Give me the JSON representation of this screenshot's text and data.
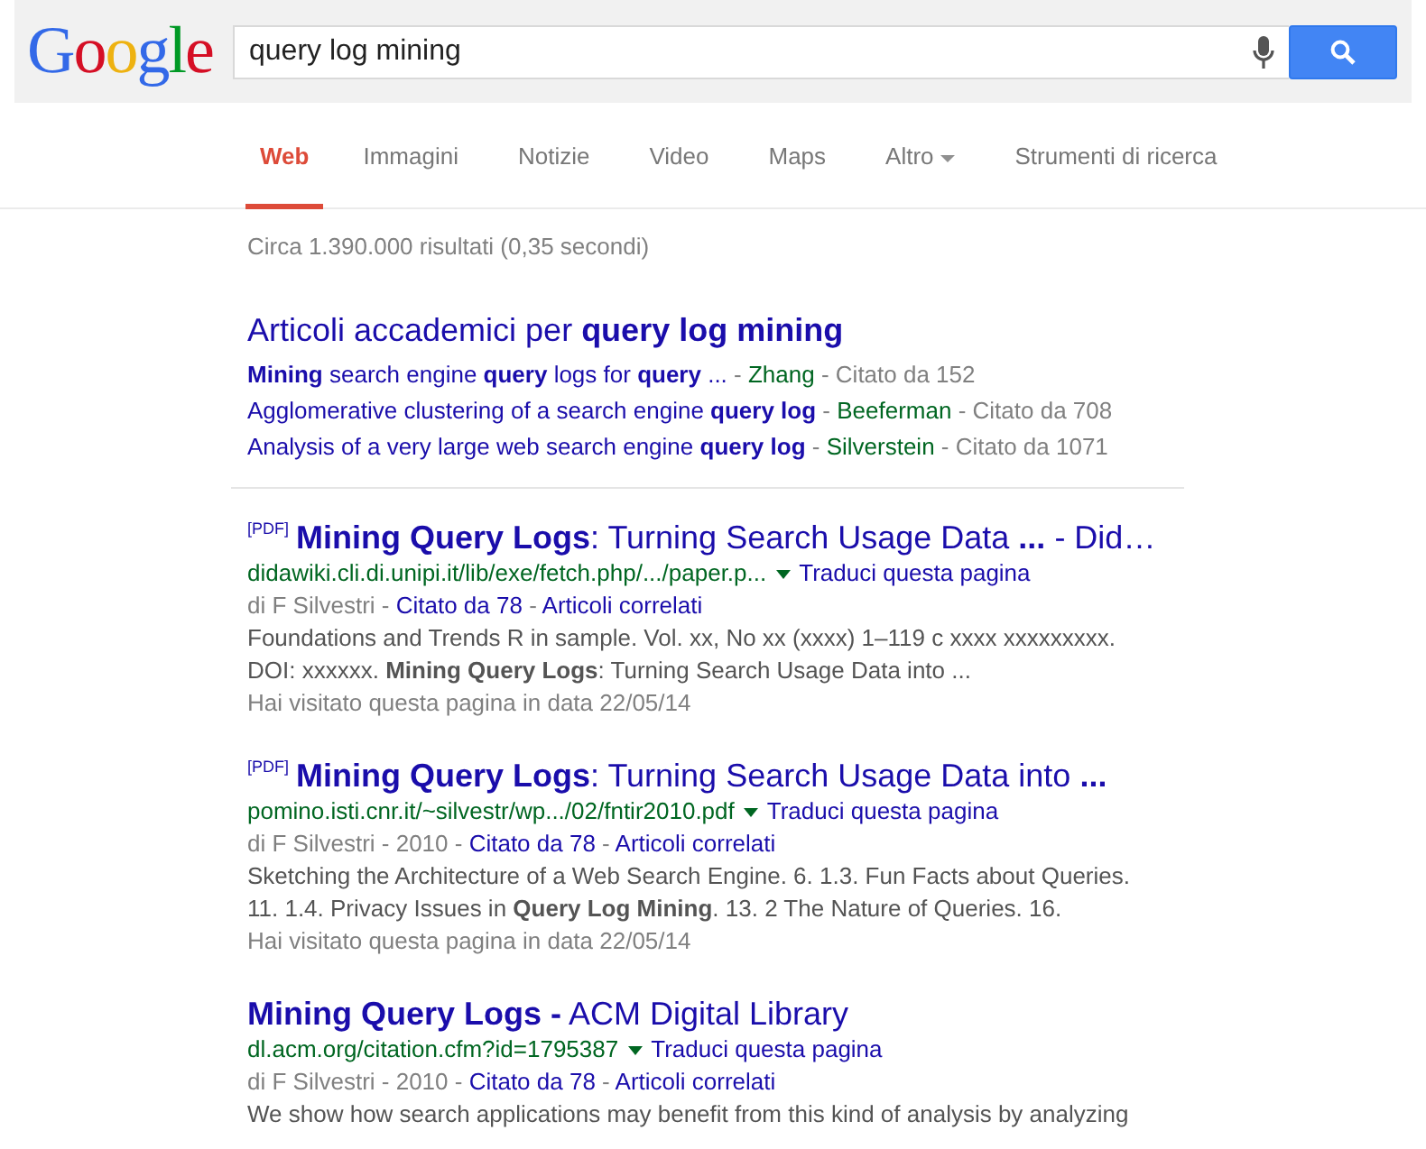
{
  "logo": "Google",
  "search": {
    "value": "query log mining"
  },
  "tabs": [
    {
      "label": "Web",
      "selected": true,
      "dropdown": false
    },
    {
      "label": "Immagini",
      "selected": false,
      "dropdown": false
    },
    {
      "label": "Notizie",
      "selected": false,
      "dropdown": false
    },
    {
      "label": "Video",
      "selected": false,
      "dropdown": false
    },
    {
      "label": "Maps",
      "selected": false,
      "dropdown": false
    },
    {
      "label": "Altro",
      "selected": false,
      "dropdown": true
    },
    {
      "label": "Strumenti di ricerca",
      "selected": false,
      "dropdown": false
    }
  ],
  "result_stats": "Circa 1.390.000 risultati (0,35 secondi)",
  "scholar": {
    "title": "Articoli accademici per **query log mining**",
    "lines": [
      [
        {
          "kind": "link",
          "text": "**Mining** search engine **query** logs for **query** ..."
        },
        {
          "kind": "plain",
          "text": " - "
        },
        {
          "kind": "author",
          "text": "Zhang"
        },
        {
          "kind": "plain",
          "text": " - Citato da 152"
        }
      ],
      [
        {
          "kind": "link",
          "text": "Agglomerative clustering of a search engine **query log**"
        },
        {
          "kind": "plain",
          "text": " - "
        },
        {
          "kind": "author",
          "text": "Beeferman"
        },
        {
          "kind": "plain",
          "text": " - Citato da 708"
        }
      ],
      [
        {
          "kind": "link",
          "text": "Analysis of a very large web search engine **query log**"
        },
        {
          "kind": "plain",
          "text": " - "
        },
        {
          "kind": "author",
          "text": "Silverstein"
        },
        {
          "kind": "plain",
          "text": " - Citato da 1071"
        }
      ]
    ]
  },
  "results": [
    {
      "tag": "[PDF]",
      "title": "**Mining Query Logs**: Turning Search Usage Data **...** - Did…",
      "url": "didawiki.cli.di.unipi.it/lib/exe/fetch.php/.../paper.p...",
      "translate": "Traduci questa pagina",
      "meta": [
        {
          "kind": "plain",
          "text": "di F Silvestri - "
        },
        {
          "kind": "link",
          "text": "Citato da 78"
        },
        {
          "kind": "plain",
          "text": " - "
        },
        {
          "kind": "link",
          "text": "Articoli correlati"
        }
      ],
      "snippet": "Foundations and Trends R in sample. Vol. xx, No xx (xxxx) 1–119 c xxxx xxxxxxxxx. DOI: xxxxxx. **Mining Query Logs**: Turning Search Usage Data into ...",
      "visited": "Hai visitato questa pagina in data 22/05/14"
    },
    {
      "tag": "[PDF]",
      "title": "**Mining Query Logs**: Turning Search Usage Data into **...**",
      "url": "pomino.isti.cnr.it/~silvestr/wp.../02/fntir2010.pdf",
      "translate": "Traduci questa pagina",
      "meta": [
        {
          "kind": "plain",
          "text": "di F Silvestri - 2010 - "
        },
        {
          "kind": "link",
          "text": "Citato da 78"
        },
        {
          "kind": "plain",
          "text": " - "
        },
        {
          "kind": "link",
          "text": "Articoli correlati"
        }
      ],
      "snippet": "Sketching the Architecture of a Web Search Engine. 6. 1.3. Fun Facts about Queries. 11. 1.4. Privacy Issues in **Query Log Mining**. 13. 2 The Nature of Queries. 16.",
      "visited": "Hai visitato questa pagina in data 22/05/14"
    },
    {
      "title": "**Mining Query Logs -** ACM Digital Library",
      "url": "dl.acm.org/citation.cfm?id=1795387",
      "translate": "Traduci questa pagina",
      "meta": [
        {
          "kind": "plain",
          "text": "di F Silvestri - 2010 - "
        },
        {
          "kind": "link",
          "text": "Citato da 78"
        },
        {
          "kind": "plain",
          "text": " - "
        },
        {
          "kind": "link",
          "text": "Articoli correlati"
        }
      ],
      "snippet": "We show how search applications may benefit from this kind of analysis by analyzing"
    }
  ]
}
